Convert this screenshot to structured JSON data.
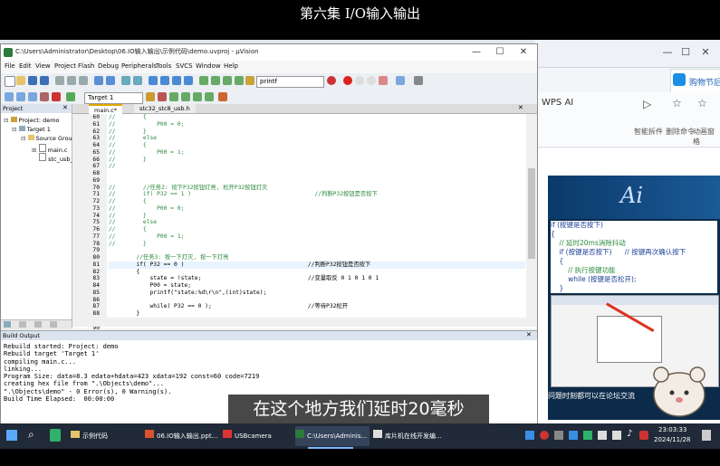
{
  "video_title": "第六集 I/O输入输出",
  "keil": {
    "title": "C:\\Users\\Administrator\\Desktop\\06.IO输入输出\\示例代码\\demo.uvproj - µVision",
    "menu": [
      "File",
      "Edit",
      "View",
      "Project",
      "Flash",
      "Debug",
      "Peripherals",
      "Tools",
      "SVCS",
      "Window",
      "Help"
    ],
    "toolbar_search_value": "printf",
    "target_select": "Target 1",
    "project_panel": {
      "header": "Project",
      "tree": [
        "Project: demo",
        "Target 1",
        "Source Grou",
        "main.c",
        "stc_usb_"
      ]
    },
    "editor_tabs": [
      "main.c*",
      "stc32_stc8_usb.h"
    ],
    "line_numbers": [
      "60",
      "61",
      "62",
      "63",
      "64",
      "65",
      "66",
      "67",
      "68",
      "69",
      "70",
      "71",
      "72",
      "73",
      "74",
      "75",
      "76",
      "77",
      "78",
      "79",
      "80",
      "81",
      "82",
      "83",
      "84",
      "85",
      "86",
      "87",
      "88",
      "89",
      "90",
      "91",
      "92"
    ],
    "code_lines": [
      "//        {",
      "//            P00 = 0;",
      "//        }",
      "//        else",
      "//        {",
      "//            P00 = 1;",
      "//        }",
      "//",
      "",
      "",
      "//        //任务2: 按下P32按钮灯亮, 松开P32按钮灯灭",
      "//        if( P32 == 1 )                                    //判断P32按钮是否按下",
      "//        {",
      "//            P00 = 0;",
      "//        }",
      "//        else",
      "//        {",
      "//            P00 = 1;",
      "//        }",
      "",
      "        //任务3: 按一下灯灭, 按一下灯亮",
      "        if( P32 == 0 )                                    //判断P32按钮是否按下",
      "        {",
      "            state = !state;                               //变量取反 0 1 0 1 0 1",
      "            P00 = state;",
      "            printf(\"state:%d\\r\\n\",(int)state);",
      "",
      "            while( P32 == 0 );                            //等待P32松开",
      "        }",
      "",
      "    }",
      "}",
      ""
    ],
    "build_output": {
      "header": "Build Output",
      "lines": [
        "Rebuild started: Project: demo",
        "Rebuild target 'Target 1'",
        "compiling main.c...",
        "linking...",
        "Program Size: data=8.3 edata+hdata=423 xdata=192 const=60 code=7219",
        "creating hex file from \".\\Objects\\demo\"...",
        "\".\\Objects\\demo\" - 0 Error(s), 0 Warning(s).",
        "Build Time Elapsed:  00:00:00"
      ]
    }
  },
  "bg_app": {
    "banner": "购物节后上",
    "wps_label": "WPS AI",
    "toolbar_items": [
      "智能拆件",
      "删除命令",
      "动画窗格"
    ],
    "slide": {
      "logo": "Ai",
      "code_lines": [
        "if (按键是否按下)",
        "{",
        "    // 延时20ms消除抖动",
        "    if (按键是否按下)      // 按键再次确认按下",
        "    {",
        "        // 执行按键功能",
        "        while (按键是否松开);",
        "    }",
        "}"
      ],
      "footer": "问题时刻都可以在论坛交流"
    }
  },
  "subtitle": "在这个地方我们延时20毫秒",
  "taskbar": {
    "tasks": [
      "示例代码",
      "06.IO输入输出.ppt...",
      "USBcamera",
      "C:\\Users\\Adminis...",
      "库片机在线开发编..."
    ],
    "time": "23:03:33",
    "date": "2024/11/28"
  }
}
